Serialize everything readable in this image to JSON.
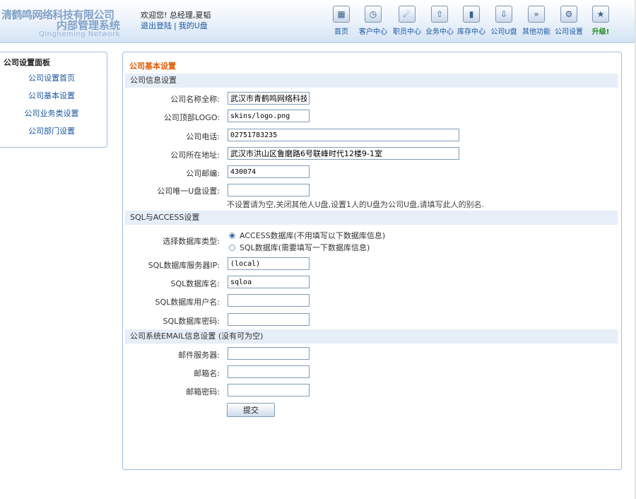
{
  "header": {
    "logo_line1": "清鹤鸣网络科技有限公司",
    "logo_line2": "内部管理系统",
    "logo_line3": "Qingheming Network",
    "welcome_text": "欢迎您! 总经理,夏韬",
    "logout_link": "退出登陆",
    "separator": "|",
    "my_disk_link": "我的U盘",
    "nav": [
      {
        "label": "首页",
        "icon": "home-icon"
      },
      {
        "label": "客户中心",
        "icon": "customer-icon"
      },
      {
        "label": "职员中心",
        "icon": "staff-icon"
      },
      {
        "label": "业务中心",
        "icon": "business-icon"
      },
      {
        "label": "库存中心",
        "icon": "inventory-icon"
      },
      {
        "label": "公司U盘",
        "icon": "disk-icon"
      },
      {
        "label": "其他功能",
        "icon": "more-icon"
      },
      {
        "label": "公司设置",
        "icon": "settings-icon"
      },
      {
        "label": "升级!",
        "icon": "upgrade-icon"
      }
    ]
  },
  "sidebar": {
    "title": "公司设置面板",
    "items": [
      {
        "label": "公司设置首页"
      },
      {
        "label": "公司基本设置"
      },
      {
        "label": "公司业务类设置"
      },
      {
        "label": "公司部门设置"
      }
    ]
  },
  "main": {
    "title": "公司基本设置",
    "sections": {
      "company_info": "公司信息设置",
      "sql_access": "SQL与ACCESS设置",
      "email": "公司系统EMAIL信息设置 (没有可为空)"
    },
    "fields": {
      "company_name": {
        "label": "公司名称全称:",
        "value": "武汉市青鹤鸣网络科技有"
      },
      "top_logo": {
        "label": "公司顶部LOGO:",
        "value": "skins/logo.png"
      },
      "phone": {
        "label": "公司电话:",
        "value": "02751783235"
      },
      "address": {
        "label": "公司所在地址:",
        "value": "武汉市洪山区鲁磨路6号联峰时代12楼9-1室"
      },
      "postcode": {
        "label": "公司邮编:",
        "value": "430074"
      },
      "unique_disk": {
        "label": "公司唯一U盘设置:",
        "value": ""
      },
      "db_type_label": "选择数据库类型:",
      "sql_server_ip": {
        "label": "SQL数据库服务器IP:",
        "value": "(local)"
      },
      "sql_db_name": {
        "label": "SQL数据库名:",
        "value": "sqloa"
      },
      "sql_user": {
        "label": "SQL数据库用户名:",
        "value": ""
      },
      "sql_password": {
        "label": "SQL数据库密码:",
        "value": ""
      },
      "mail_server": {
        "label": "邮件服务器:",
        "value": ""
      },
      "mail_name": {
        "label": "邮箱名:",
        "value": ""
      },
      "mail_password": {
        "label": "邮箱密码:",
        "value": ""
      }
    },
    "unique_disk_hint": "不设置请为空,关闭其他人U盘,设置1人的U盘为公司U盘,请填写此人的别名.",
    "db_options": [
      {
        "label": "ACCESS数据库(不用填写以下数据库信息)",
        "checked": true
      },
      {
        "label": "SQL数据库(需要填写一下数据库信息)",
        "checked": false
      }
    ],
    "submit_label": "提交"
  }
}
